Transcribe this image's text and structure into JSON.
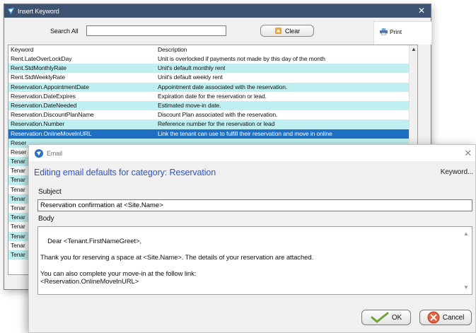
{
  "keyword_window": {
    "title": "Insert Keyword",
    "search_label": "Search All",
    "search_value": "",
    "clear_label": "Clear",
    "print_label": "Print",
    "columns": [
      "Keyword",
      "Description"
    ],
    "rows": [
      {
        "keyword": "Rent.LateOverLockDay",
        "description": "Unit is overlocked if payments not made by this day of the month",
        "style": "plain"
      },
      {
        "keyword": "Rent.StdMonthlyRate",
        "description": "Unit's default monthly rent",
        "style": "alt"
      },
      {
        "keyword": "Rent.StdWeeklyRate",
        "description": "Unit's default weekly rent",
        "style": "plain"
      },
      {
        "keyword": "Reservation.AppointmentDate",
        "description": "Appointment date associated with the reservation.",
        "style": "alt"
      },
      {
        "keyword": "Reservation.DateExpires",
        "description": "Expiration date for the reservation or lead.",
        "style": "plain"
      },
      {
        "keyword": "Reservation.DateNeeded",
        "description": "Estimated move-in date.",
        "style": "alt"
      },
      {
        "keyword": "Reservation.DiscountPlanName",
        "description": "Discount Plan associated with the reservation.",
        "style": "plain"
      },
      {
        "keyword": "Reservation.Number",
        "description": "Reference number for the reservation or lead",
        "style": "alt"
      },
      {
        "keyword": "Reservation.OnlineMoveInURL",
        "description": "Link the tenant can use to fulfill their reservation and move in online",
        "style": "selected"
      },
      {
        "keyword": "Reser",
        "description": "",
        "style": "alt"
      },
      {
        "keyword": "Reser",
        "description": "",
        "style": "plain"
      },
      {
        "keyword": "Tenar",
        "description": "",
        "style": "alt"
      },
      {
        "keyword": "Tenar",
        "description": "",
        "style": "plain"
      },
      {
        "keyword": "Tenar",
        "description": "",
        "style": "alt"
      },
      {
        "keyword": "Tenar",
        "description": "",
        "style": "plain"
      },
      {
        "keyword": "Tenar",
        "description": "",
        "style": "alt"
      },
      {
        "keyword": "Tenar",
        "description": "",
        "style": "plain"
      },
      {
        "keyword": "Tenar",
        "description": "",
        "style": "alt"
      },
      {
        "keyword": "Tenar",
        "description": "",
        "style": "plain"
      },
      {
        "keyword": "Tenar",
        "description": "",
        "style": "alt"
      },
      {
        "keyword": "Tenar",
        "description": "",
        "style": "plain"
      },
      {
        "keyword": "Tenar",
        "description": "",
        "style": "alt"
      }
    ]
  },
  "email_dialog": {
    "title": "Email",
    "heading": "Editing email defaults for category: Reservation",
    "keyword_link": "Keyword...",
    "subject_label": "Subject",
    "subject_value": "Reservation confirmation at <Site.Name>",
    "body_label": "Body",
    "body_text": "Dear <Tenant.FirstNameGreet>,\n\nThank you for reserving a space at <Site.Name>. The details of your reservation are attached.\n\nYou can also complete your move-in at the follow link:\n<Reservation.OnlineMoveInURL>",
    "ok_label": "OK",
    "cancel_label": "Cancel"
  },
  "colors": {
    "titlebar": "#3e5371",
    "alt_row": "#bfeff0",
    "selected_row": "#1f6fc4",
    "heading": "#2d55c8"
  },
  "icons": [
    "app-logo-icon",
    "close-icon",
    "broom-icon",
    "printer-icon",
    "checkmark-icon",
    "cancel-icon",
    "scroll-up-icon",
    "scroll-down-icon"
  ]
}
